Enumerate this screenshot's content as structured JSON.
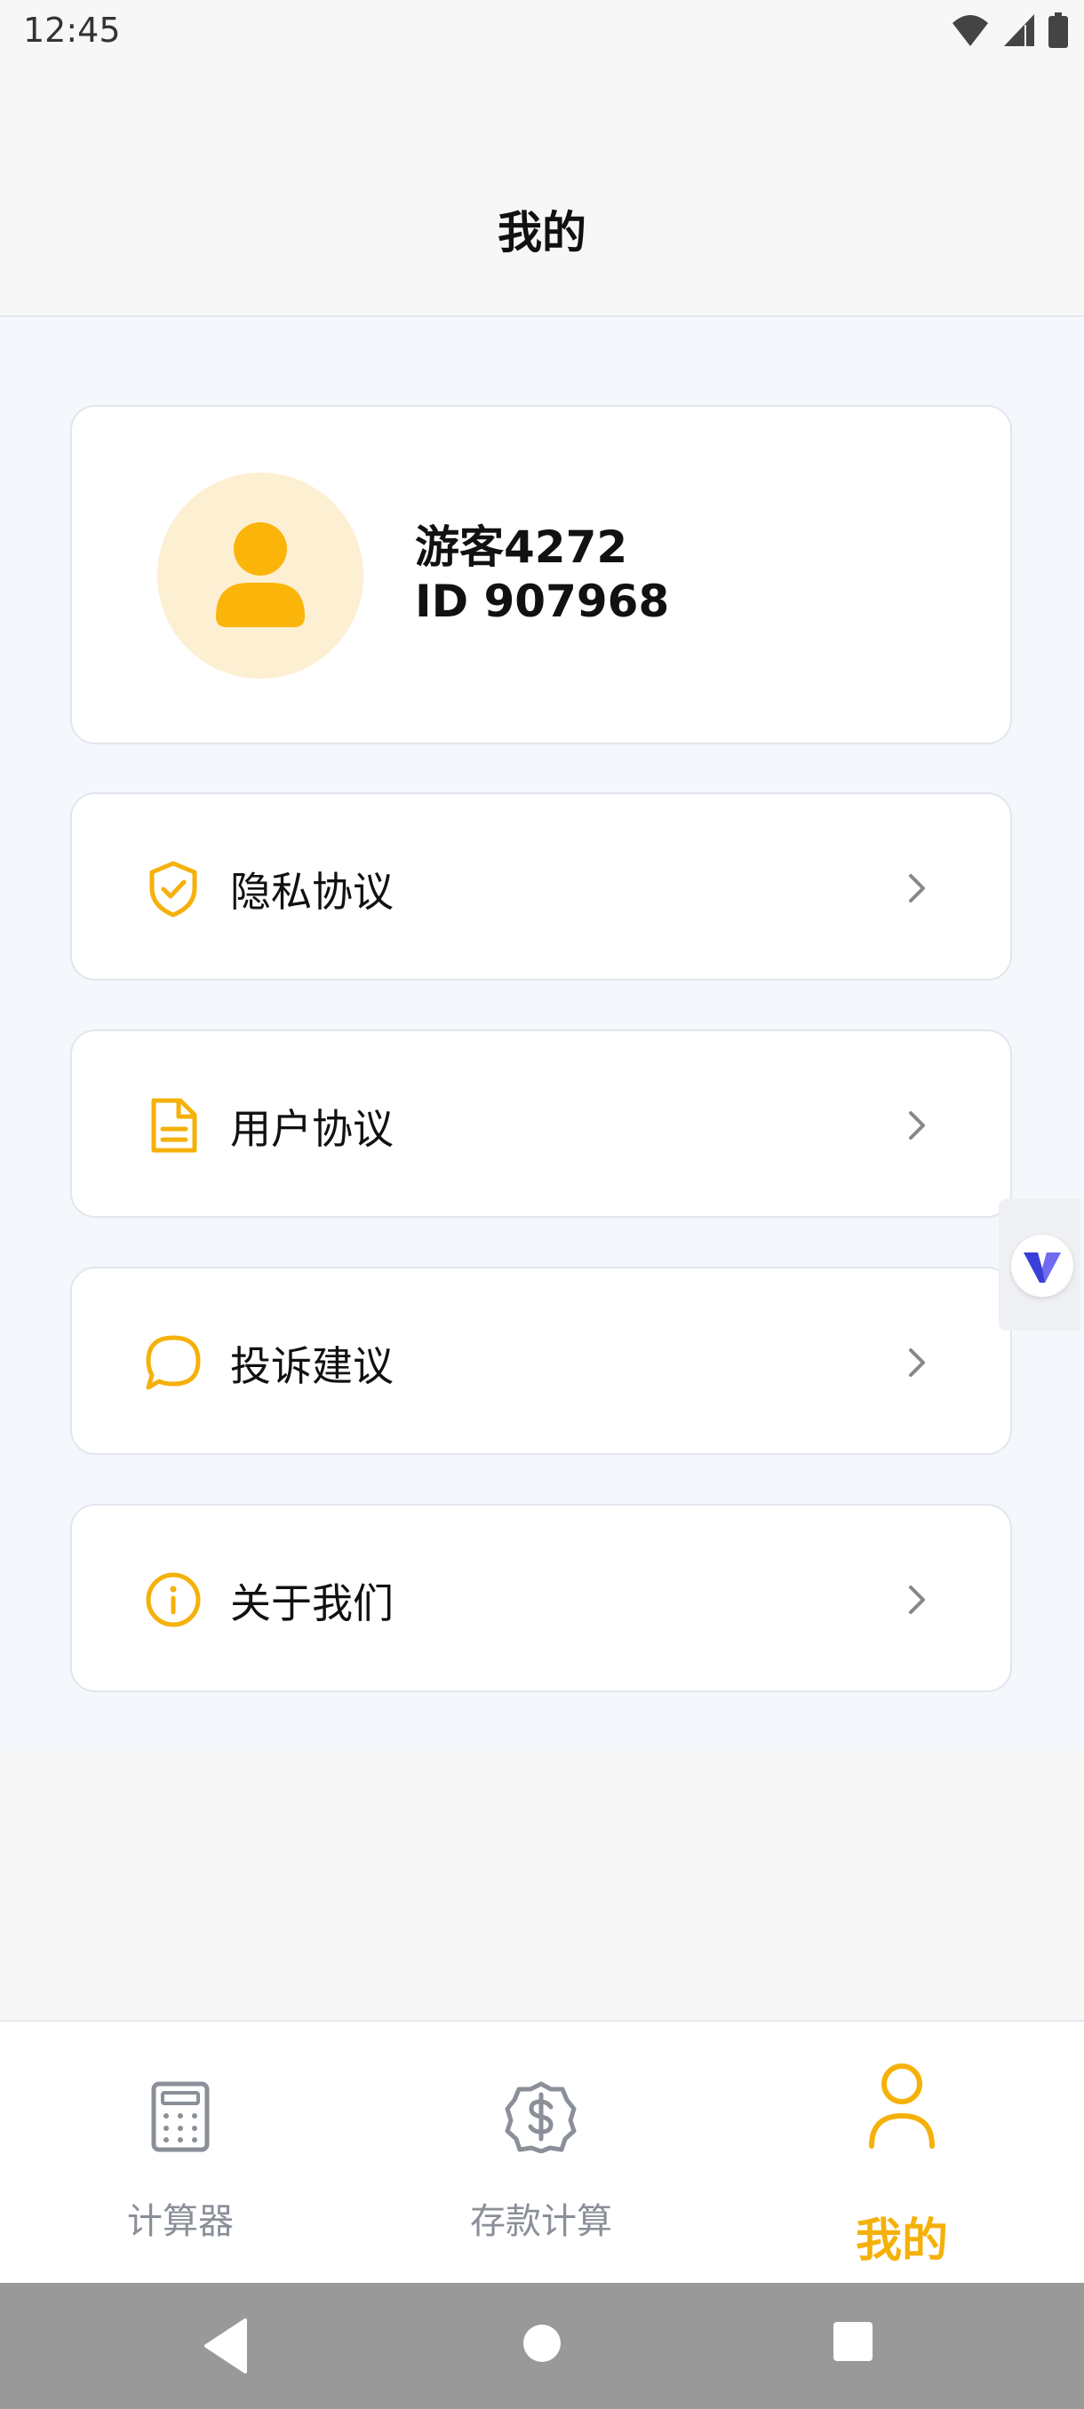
{
  "status": {
    "time": "12:45"
  },
  "header": {
    "title": "我的"
  },
  "profile": {
    "name": "游客4272",
    "id": "ID 907968"
  },
  "menu": [
    {
      "icon": "shield-check-icon",
      "label": "隐私协议"
    },
    {
      "icon": "document-icon",
      "label": "用户协议"
    },
    {
      "icon": "chat-bubble-icon",
      "label": "投诉建议"
    },
    {
      "icon": "info-icon",
      "label": "关于我们"
    }
  ],
  "tabs": [
    {
      "icon": "calculator-icon",
      "label": "计算器",
      "active": false
    },
    {
      "icon": "dollar-badge-icon",
      "label": "存款计算",
      "active": false
    },
    {
      "icon": "person-icon",
      "label": "我的",
      "active": true
    }
  ],
  "colors": {
    "accent": "#f5b10a",
    "avatar_bg": "#fdefd2",
    "page_bg": "#f4f7fb",
    "inactive_tab": "#8a8f98"
  }
}
